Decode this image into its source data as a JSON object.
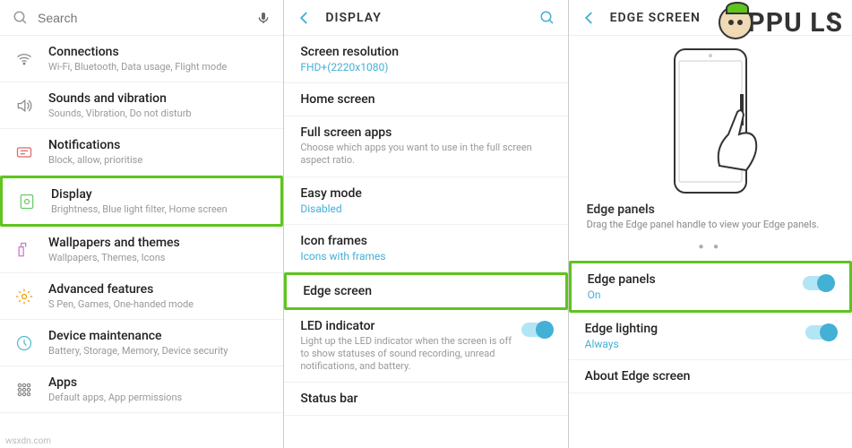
{
  "watermark": {
    "brand_prefix": "PPU",
    "brand_suffix": "LS"
  },
  "footer_watermark": "wsxdn.com",
  "col1": {
    "search_placeholder": "Search",
    "items": [
      {
        "icon": "wifi",
        "title": "Connections",
        "sub": "Wi-Fi, Bluetooth, Data usage, Flight mode",
        "highlight": false
      },
      {
        "icon": "sound",
        "title": "Sounds and vibration",
        "sub": "Sounds, Vibration, Do not disturb",
        "highlight": false
      },
      {
        "icon": "notif",
        "title": "Notifications",
        "sub": "Block, allow, prioritise",
        "highlight": false
      },
      {
        "icon": "display",
        "title": "Display",
        "sub": "Brightness, Blue light filter, Home screen",
        "highlight": true
      },
      {
        "icon": "wallpaper",
        "title": "Wallpapers and themes",
        "sub": "Wallpapers, Themes, Icons",
        "highlight": false
      },
      {
        "icon": "advanced",
        "title": "Advanced features",
        "sub": "S Pen, Games, One-handed mode",
        "highlight": false
      },
      {
        "icon": "maintenance",
        "title": "Device maintenance",
        "sub": "Battery, Storage, Memory, Device security",
        "highlight": false
      },
      {
        "icon": "apps",
        "title": "Apps",
        "sub": "Default apps, App permissions",
        "highlight": false
      }
    ]
  },
  "col2": {
    "header": "DISPLAY",
    "items": [
      {
        "title": "Screen resolution",
        "link": "FHD+(2220x1080)"
      },
      {
        "title": "Home screen"
      },
      {
        "title": "Full screen apps",
        "sub": "Choose which apps you want to use in the full screen aspect ratio."
      },
      {
        "title": "Easy mode",
        "link": "Disabled"
      },
      {
        "title": "Icon frames",
        "link": "Icons with frames"
      },
      {
        "title": "Edge screen",
        "highlight": true
      },
      {
        "title": "LED indicator",
        "sub": "Light up the LED indicator when the screen is off to show statuses of sound recording, unread notifications, and battery.",
        "toggle": true
      },
      {
        "title": "Status bar"
      }
    ]
  },
  "col3": {
    "header": "EDGE SCREEN",
    "intro_title": "Edge panels",
    "intro_sub": "Drag the Edge panel handle to view your Edge panels.",
    "items": [
      {
        "title": "Edge panels",
        "link": "On",
        "toggle": true,
        "highlight": true
      },
      {
        "title": "Edge lighting",
        "link": "Always",
        "toggle": true
      },
      {
        "title": "About Edge screen"
      }
    ]
  }
}
